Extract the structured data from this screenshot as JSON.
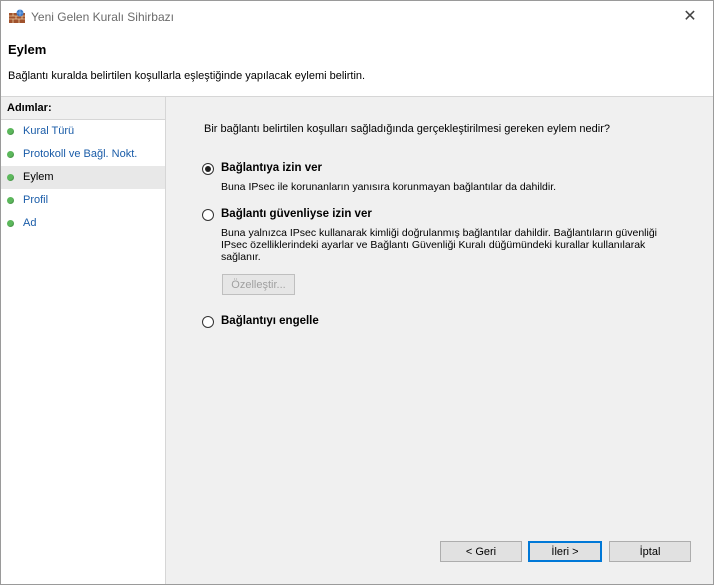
{
  "window": {
    "title": "Yeni Gelen Kuralı Sihirbazı",
    "close": "✕"
  },
  "header": {
    "title": "Eylem",
    "description": "Bağlantı kuralda belirtilen koşullarla eşleştiğinde yapılacak eylemi belirtin."
  },
  "sidebar": {
    "heading": "Adımlar:",
    "steps": [
      {
        "label": "Kural Türü"
      },
      {
        "label": "Protokoll ve Bağl. Nokt."
      },
      {
        "label": "Eylem",
        "active": true
      },
      {
        "label": "Profil"
      },
      {
        "label": "Ad"
      }
    ]
  },
  "main": {
    "question": "Bir bağlantı belirtilen koşulları sağladığında gerçekleştirilmesi gereken eylem nedir?",
    "options": [
      {
        "label": "Bağlantıya izin ver",
        "description": "Buna IPsec ile korunanların yanısıra korunmayan bağlantılar da dahildir.",
        "checked": true
      },
      {
        "label": "Bağlantı güvenliyse izin ver",
        "description": "Buna yalnızca IPsec kullanarak kimliği doğrulanmış bağlantılar dahildir. Bağlantıların güvenliği IPsec özelliklerindeki ayarlar ve Bağlantı Güvenliği Kuralı düğümündeki kurallar kullanılarak sağlanır.",
        "checked": false
      },
      {
        "label": "Bağlantıyı engelle",
        "description": "",
        "checked": false
      }
    ],
    "customize_button": "Özelleştir..."
  },
  "footer": {
    "back": "< Geri",
    "next": "İleri >",
    "cancel": "İptal"
  },
  "colors": {
    "link": "#1a5ca8",
    "dot": "#5cb85c",
    "panel": "#f0f0f0",
    "focus": "#0078d7"
  },
  "icons": {
    "title": "firewall-wall-icon",
    "step": "green-dot-icon"
  }
}
